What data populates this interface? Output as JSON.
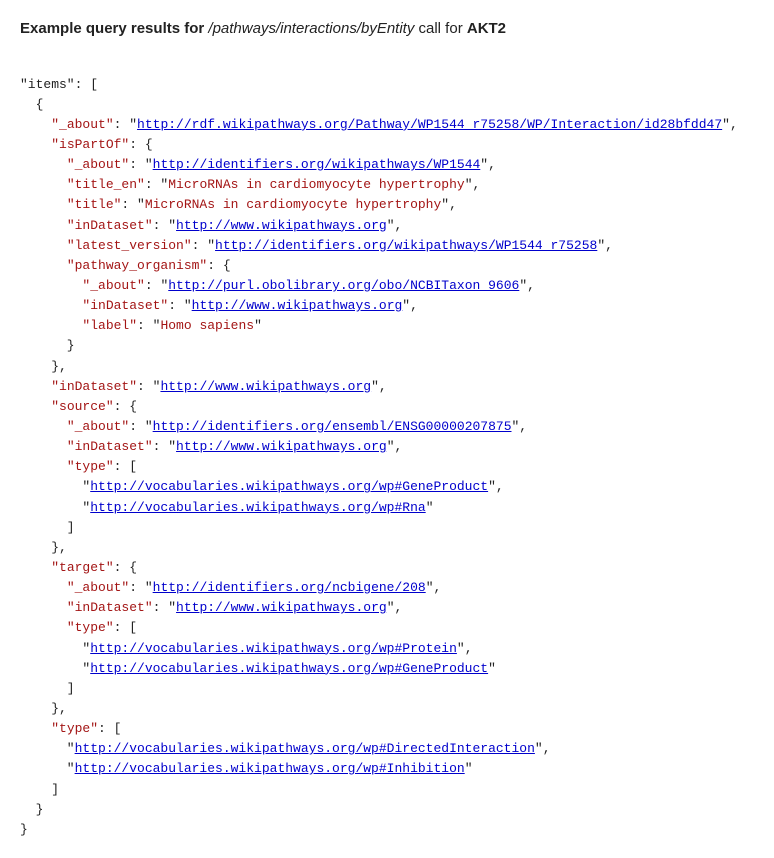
{
  "header": {
    "prefix": "Example query results for ",
    "path": "/pathways/interactions/byEntity",
    "suffix": " call for ",
    "entity": "AKT2"
  },
  "json": {
    "items_label": "\"items\"",
    "about_interaction": "http://rdf.wikipathways.org/Pathway/WP1544_r75258/WP/Interaction/id28bfdd47",
    "isPartOf_about": "http://identifiers.org/wikipathways/WP1544",
    "title_en": "MicroRNAs in cardiomyocyte hypertrophy",
    "title": "MicroRNAs in cardiomyocyte hypertrophy",
    "inDataset_main": "http://www.wikipathways.org",
    "latest_version": "http://identifiers.org/wikipathways/WP1544_r75258",
    "pathway_organism_about": "http://purl.obolibrary.org/obo/NCBITaxon_9606",
    "pathway_organism_inDataset": "http://www.wikipathways.org",
    "pathway_organism_label": "Homo sapiens",
    "inDataset_second": "http://www.wikipathways.org",
    "source_about": "http://identifiers.org/ensembl/ENSG00000207875",
    "source_inDataset": "http://www.wikipathways.org",
    "source_type1": "http://vocabularies.wikipathways.org/wp#GeneProduct",
    "source_type2": "http://vocabularies.wikipathways.org/wp#Rna",
    "target_about": "http://identifiers.org/ncbigene/208",
    "target_inDataset": "http://www.wikipathways.org",
    "target_type1": "http://vocabularies.wikipathways.org/wp#Protein",
    "target_type2": "http://vocabularies.wikipathways.org/wp#GeneProduct",
    "type1": "http://vocabularies.wikipathways.org/wp#DirectedInteraction",
    "type2": "http://vocabularies.wikipathways.org/wp#Inhibition"
  }
}
